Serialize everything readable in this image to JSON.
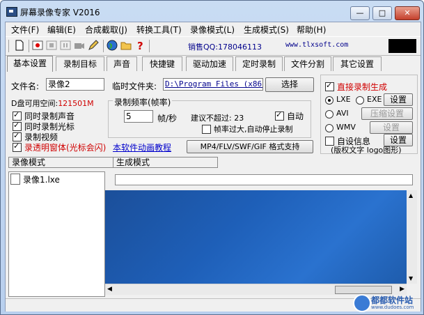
{
  "window": {
    "title": "屏幕录像专家 V2016"
  },
  "menu": [
    "文件(F)",
    "编辑(E)",
    "合成截取(J)",
    "转换工具(T)",
    "录像模式(L)",
    "生成模式(S)",
    "帮助(H)"
  ],
  "toolbar": {
    "icons": [
      "new-file-icon",
      "record-icon",
      "stop-icon",
      "pause-icon",
      "camera-icon",
      "pencil-icon",
      "globe-icon",
      "folder-icon",
      "help-icon"
    ],
    "sales": "销售QQ:178046113",
    "site": "www.tlxsoft.com"
  },
  "tabs": [
    "基本设置",
    "录制目标",
    "声音",
    "快捷键",
    "驱动加速",
    "定时录制",
    "文件分割",
    "其它设置"
  ],
  "basic": {
    "filename_label": "文件名:",
    "filename_value": "录像2",
    "tempdir_label": "临时文件夹:",
    "tempdir_value": "D:\\Program Files (x86)\\",
    "choose_button": "选择",
    "disk_label": "D盘可用空间:",
    "disk_value": "121501M",
    "checks": [
      {
        "label": "同时录制声音",
        "checked": true
      },
      {
        "label": "同时录制光标",
        "checked": true
      },
      {
        "label": "录制视频",
        "checked": true
      },
      {
        "label": "录透明窗体(光标会闪)",
        "checked": true
      }
    ],
    "tutorial_link": "本软件动画教程",
    "freq_group": "录制频率(帧率)",
    "fps_value": "5",
    "fps_unit": "帧/秒",
    "suggest": "建议不超过: 23",
    "auto_label": "自动",
    "auto_checked": true,
    "stop_label": "帧率过大,自动停止录制",
    "stop_checked": false,
    "format_button": "MP4/FLV/SWF/GIF  格式支持"
  },
  "right": {
    "direct_label": "直接录制生成",
    "direct_checked": true,
    "lxe": "LXE",
    "exe": "EXE",
    "settings1": "设置",
    "avi": "AVI",
    "compress": "压缩设置",
    "wmv": "WMV",
    "settings2": "设置",
    "custom_label": "自设信息",
    "settings3": "设置",
    "note": "(版权文字 logo图形)"
  },
  "bottom_tabs": {
    "record": "录像模式",
    "generate": "生成模式"
  },
  "list": [
    "录像1.lxe"
  ],
  "watermark": {
    "brand": "都都软件站",
    "url": "www.dudoes.com"
  }
}
